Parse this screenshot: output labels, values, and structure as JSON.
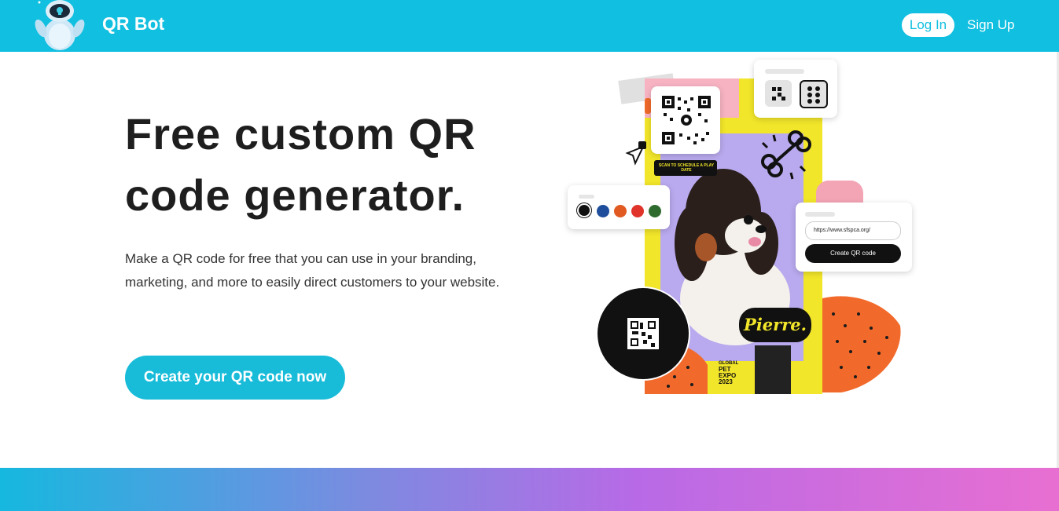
{
  "header": {
    "brand": "QR Bot",
    "login_label": "Log In",
    "signup_label": "Sign Up"
  },
  "hero": {
    "headline": "Free custom QR code generator.",
    "description": "Make a QR code for free that you can use in your branding, marketing, and more to easily direct customers to your website.",
    "cta_label": "Create your QR code now"
  },
  "illustration": {
    "scan_text": "SCAN TO SCHEDULE A PLAY DATE",
    "name_tag": "Pierre.",
    "expo_text": [
      "GLOBAL",
      "PET",
      "EXPO",
      "2023"
    ],
    "url_value": "https://www.sfspca.org/",
    "create_button": "Create QR code",
    "swatches": [
      "#111111",
      "#1f4e9c",
      "#e05a22",
      "#e0342a",
      "#2f6b2f"
    ]
  },
  "colors": {
    "accent": "#11bfe0",
    "button": "#18bcd9"
  }
}
